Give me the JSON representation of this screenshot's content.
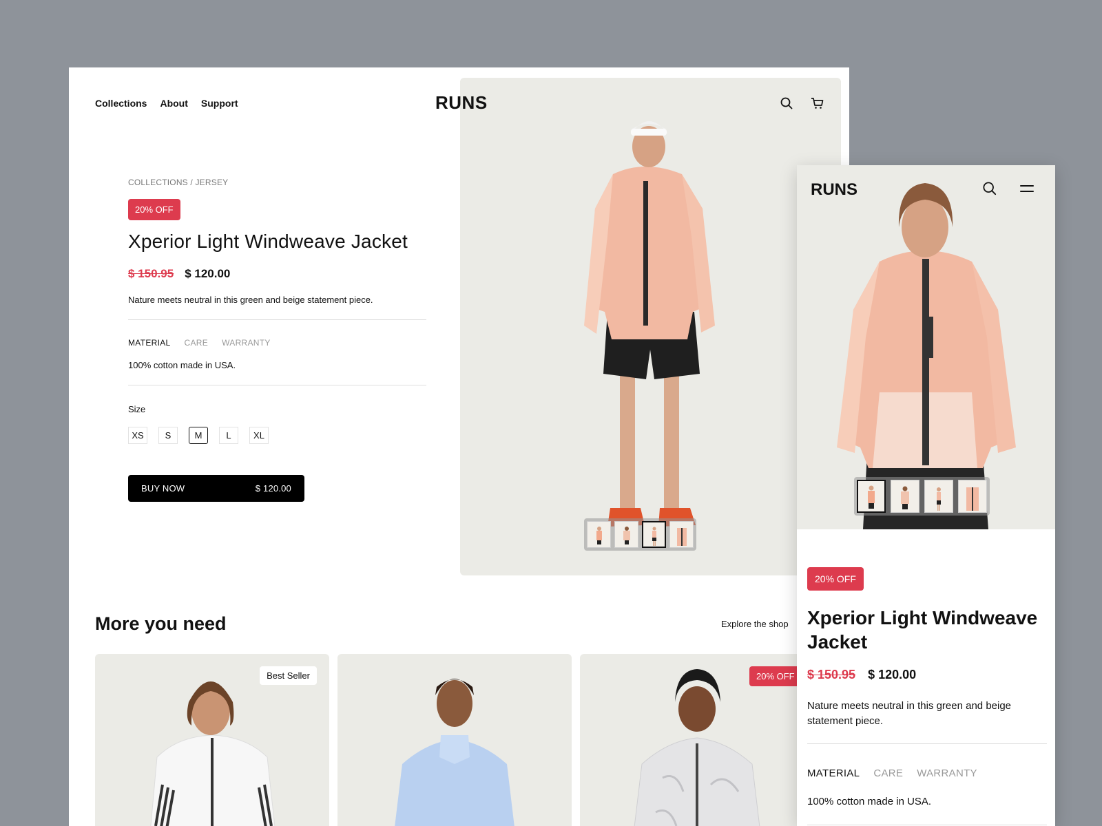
{
  "desktop": {
    "nav": [
      "Collections",
      "About",
      "Support"
    ],
    "logo": "RUNS",
    "breadcrumb": "COLLECTIONS / JERSEY",
    "badge": "20% OFF",
    "title": "Xperior Light Windweave Jacket",
    "old_price": "$ 150.95",
    "price": "$ 120.00",
    "description": "Nature meets neutral in this green and beige statement piece.",
    "tabs": [
      "MATERIAL",
      "CARE",
      "WARRANTY"
    ],
    "active_tab": "MATERIAL",
    "tab_text": "100% cotton made in USA.",
    "size_label": "Size",
    "sizes": [
      "XS",
      "S",
      "M",
      "L",
      "XL"
    ],
    "selected_size": "M",
    "buy_label": "BUY NOW",
    "buy_price": "$ 120.00",
    "section_title": "More you  need",
    "explore": "Explore the shop",
    "cards": [
      {
        "tag": "Best Seller"
      },
      {
        "tag": ""
      },
      {
        "badge": "20% OFF"
      }
    ]
  },
  "mobile": {
    "logo": "RUNS",
    "badge": "20% OFF",
    "title": "Xperior Light Windweave Jacket",
    "old_price": "$ 150.95",
    "price": "$ 120.00",
    "description": "Nature meets neutral in this green and beige statement piece.",
    "tabs": [
      "MATERIAL",
      "CARE",
      "WARRANTY"
    ],
    "tab_text": "100% cotton made in USA."
  },
  "colors": {
    "page_bg": "#8e939a",
    "accent_red": "#dd3b4e",
    "hero_bg": "#ebebe6",
    "jacket_peach": "#f2a98c"
  },
  "icons": [
    "search-icon",
    "cart-icon",
    "menu-icon"
  ]
}
